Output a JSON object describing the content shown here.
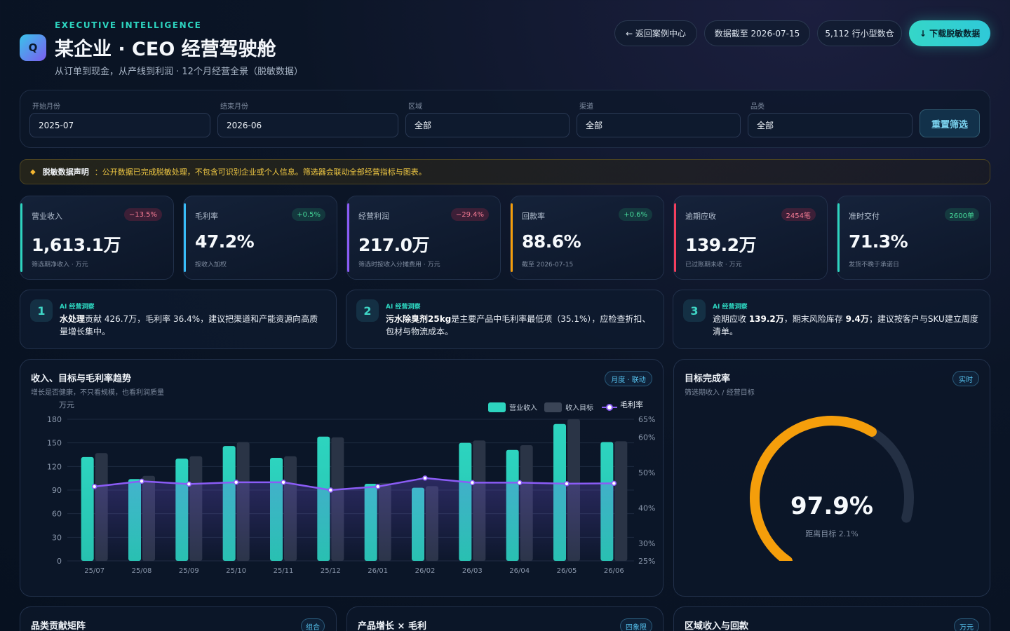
{
  "header": {
    "logo_letter": "Q",
    "eyebrow": "EXECUTIVE INTELLIGENCE",
    "title": "某企业 · CEO 经营驾驶舱",
    "subtitle": "从订单到现金，从产线到利润 · 12个月经营全景（脱敏数据）",
    "back_label": "← 返回案例中心",
    "data_date": "数据截至 2026-07-15",
    "records": "5,112 行小型数仓",
    "download_label": "↓ 下载脱敏数据"
  },
  "filters": {
    "start_label": "开始月份",
    "start_value": "2025-07",
    "end_label": "结束月份",
    "end_value": "2026-06",
    "region_label": "区域",
    "region_value": "全部",
    "channel_label": "渠道",
    "channel_value": "全部",
    "category_label": "品类",
    "category_value": "全部",
    "reset_label": "重置筛选"
  },
  "notice": {
    "title": "脱敏数据声明",
    "text": "：公开数据已完成脱敏处理，不包含可识别企业或个人信息。筛选器会联动全部经营指标与图表。"
  },
  "kpis": [
    {
      "label": "营业收入",
      "value": "1,613.1万",
      "badge": "−13.5%",
      "note": "筛选期净收入 · 万元",
      "color": "#2dd4bf",
      "badge_type": "neg"
    },
    {
      "label": "毛利率",
      "value": "47.2%",
      "badge": "+0.5%",
      "note": "按收入加权",
      "color": "#38bdf8",
      "badge_type": "pos"
    },
    {
      "label": "经营利润",
      "value": "217.0万",
      "badge": "−29.4%",
      "note": "筛选时按收入分摊费用 · 万元",
      "color": "#8b5cf6",
      "badge_type": "neg"
    },
    {
      "label": "回款率",
      "value": "88.6%",
      "badge": "+0.6%",
      "note": "截至 2026-07-15",
      "color": "#f59e0b",
      "badge_type": "pos"
    },
    {
      "label": "逾期应收",
      "value": "139.2万",
      "badge": "2454笔",
      "note": "已过账期未收 · 万元",
      "color": "#f43f5e",
      "badge_type": "neg"
    },
    {
      "label": "准时交付",
      "value": "71.3%",
      "badge": "2600单",
      "note": "发货不晚于承诺日",
      "color": "#2dd4bf",
      "badge_type": "pos"
    }
  ],
  "insights": [
    {
      "num": "1",
      "tag": "AI 经营洞察",
      "pre": "",
      "bold1": "水处理",
      "mid": "贡献 426.7万，毛利率 36.4%，建议把渠道和产能资源向高质量增长集中。",
      "bold2": "",
      "post": ""
    },
    {
      "num": "2",
      "tag": "AI 经营洞察",
      "pre": "",
      "bold1": "污水除臭剂25kg",
      "mid": "是主要产品中毛利率最低项（35.1%），应检查折扣、包材与物流成本。",
      "bold2": "",
      "post": ""
    },
    {
      "num": "3",
      "tag": "AI 经营洞察",
      "pre": "逾期应收 ",
      "bold1": "139.2万",
      "mid": "，期末风险库存 ",
      "bold2": "9.4万",
      "post": "；建议按客户与SKU建立周度清单。"
    }
  ],
  "trend_panel": {
    "title": "收入、目标与毛利率趋势",
    "subtitle": "增长是否健康，不只看规模，也看利润质量",
    "tag": "月度 · 联动",
    "unit": "万元",
    "legend_revenue": "营业收入",
    "legend_target": "收入目标",
    "legend_margin": "毛利率"
  },
  "chart_data": {
    "type": "bar",
    "categories": [
      "25/07",
      "25/08",
      "25/09",
      "25/10",
      "25/11",
      "25/12",
      "26/01",
      "26/02",
      "26/03",
      "26/04",
      "26/05",
      "26/06"
    ],
    "series": [
      {
        "name": "营业收入",
        "type": "bar",
        "axis": "left",
        "values": [
          132,
          104,
          130,
          146,
          131,
          158,
          98,
          93,
          150,
          141,
          174,
          151
        ],
        "color": "#2dd4bf"
      },
      {
        "name": "收入目标",
        "type": "bar",
        "axis": "left",
        "values": [
          137,
          108,
          133,
          151,
          133,
          157,
          99,
          95,
          153,
          147,
          180,
          152
        ],
        "color": "#2a3446"
      },
      {
        "name": "毛利率",
        "type": "line",
        "axis": "right",
        "values": [
          46,
          47.5,
          46.7,
          47.2,
          47.2,
          45,
          46,
          48.4,
          47.1,
          47.1,
          46.8,
          46.9
        ],
        "color": "#8b5cf6"
      }
    ],
    "ylabel": "万元",
    "ylim": [
      0,
      180
    ],
    "yticks": [
      0,
      30,
      60,
      90,
      120,
      150,
      180
    ],
    "y2lim": [
      25,
      65
    ],
    "y2ticks": [
      "25%",
      "30%",
      "40%",
      "50%",
      "60%",
      "65%"
    ],
    "y2tick_values": [
      25,
      30,
      40,
      50,
      60,
      65
    ],
    "legend": "top-right",
    "grid": true
  },
  "gauge": {
    "title": "目标完成率",
    "subtitle": "筛选期收入 / 经营目标",
    "tag": "实时",
    "value": "97.9%",
    "fraction": 0.979,
    "note": "距离目标 2.1%",
    "color": "#f59e0b"
  },
  "bottom_panels": [
    {
      "title": "品类贡献矩阵",
      "tag": "组合"
    },
    {
      "title": "产品增长 × 毛利",
      "tag": "四象限"
    },
    {
      "title": "区域收入与回款",
      "tag": "万元"
    }
  ]
}
